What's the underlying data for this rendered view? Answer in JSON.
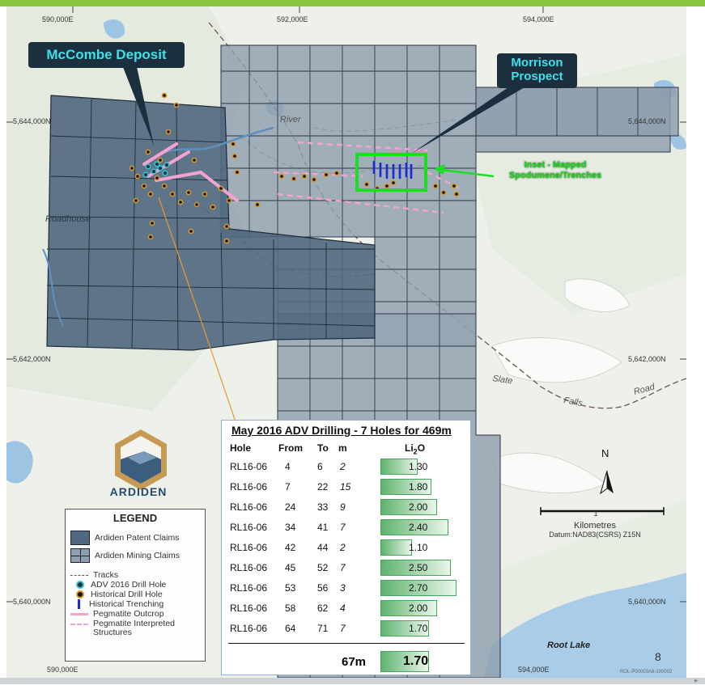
{
  "callouts": {
    "mccombe": "McCombe Deposit",
    "morrison_line1": "Morrison",
    "morrison_line2": "Prospect"
  },
  "grid_labels": {
    "top_e1": "590,000E",
    "top_e2": "592,000E",
    "top_e3": "594,000E",
    "bottom_e1": "590,000E",
    "bottom_e3": "594,000E",
    "n1_left": "5,644,000N",
    "n1_right": "5,644,000N",
    "n2_left": "5,642,000N",
    "n2_right": "5,642,000N",
    "n3_left": "5,640,000N",
    "n3_right": "5,640,000N"
  },
  "place_names": {
    "river": "River",
    "roadhouse": "Roadhouse",
    "slate": "Slate",
    "falls": "Falls",
    "road": "Road",
    "root_lake": "Root Lake"
  },
  "inset_label": "Inset - Mapped Spodumene/Trenches",
  "logo": "ARDIDEN",
  "legend": {
    "title": "LEGEND",
    "patent": "Ardiden Patent Claims",
    "mining": "Ardiden Mining Claims",
    "tracks": "Tracks",
    "adv": "ADV 2016 Drill Hole",
    "hist_drill": "Historical Drill Hole",
    "hist_trench": "Historical Trenching",
    "peg_out": "Pegmatite Outcrop",
    "peg_int1": "Pegmatite Interpreted",
    "peg_int2": "Structures"
  },
  "drill_table": {
    "title": "May 2016 ADV Drilling - 7 Holes for 469m",
    "headers": {
      "hole": "Hole",
      "from": "From",
      "to": "To",
      "m": "m",
      "li2o_main": "Li",
      "li2o_sub": "2",
      "li2o_end": "O"
    },
    "rows": [
      {
        "hole": "RL16-06",
        "from": "4",
        "to": "6",
        "m": "2",
        "li2o": "1.30",
        "v": 1.3
      },
      {
        "hole": "RL16-06",
        "from": "7",
        "to": "22",
        "m": "15",
        "li2o": "1.80",
        "v": 1.8
      },
      {
        "hole": "RL16-06",
        "from": "24",
        "to": "33",
        "m": "9",
        "li2o": "2.00",
        "v": 2.0
      },
      {
        "hole": "RL16-06",
        "from": "34",
        "to": "41",
        "m": "7",
        "li2o": "2.40",
        "v": 2.4
      },
      {
        "hole": "RL16-06",
        "from": "42",
        "to": "44",
        "m": "2",
        "li2o": "1.10",
        "v": 1.1
      },
      {
        "hole": "RL16-06",
        "from": "45",
        "to": "52",
        "m": "7",
        "li2o": "2.50",
        "v": 2.5
      },
      {
        "hole": "RL16-06",
        "from": "53",
        "to": "56",
        "m": "3",
        "li2o": "2.70",
        "v": 2.7
      },
      {
        "hole": "RL16-06",
        "from": "58",
        "to": "62",
        "m": "4",
        "li2o": "2.00",
        "v": 2.0
      },
      {
        "hole": "RL16-06",
        "from": "64",
        "to": "71",
        "m": "7",
        "li2o": "1.70",
        "v": 1.7
      }
    ],
    "total_m": "67m",
    "total_li2o": "1.70",
    "total_v": 1.7
  },
  "north": "N",
  "scale": {
    "value": "1",
    "unit": "Kilometres",
    "datum": "Datum:NAD83(CSRS) Z15N"
  },
  "page_number": "8",
  "doc_ref": "ROL-P00003A8-100002",
  "colors": {
    "accent_green": "#8cc63f",
    "claims_fill": "#50677e",
    "mining_fill": "#8ea0ae",
    "inset_box": "#18e01c",
    "callout_bg": "#1c2f3f",
    "callout_text": "#3ee0ea",
    "pegmatite": "#f4a3d0"
  }
}
